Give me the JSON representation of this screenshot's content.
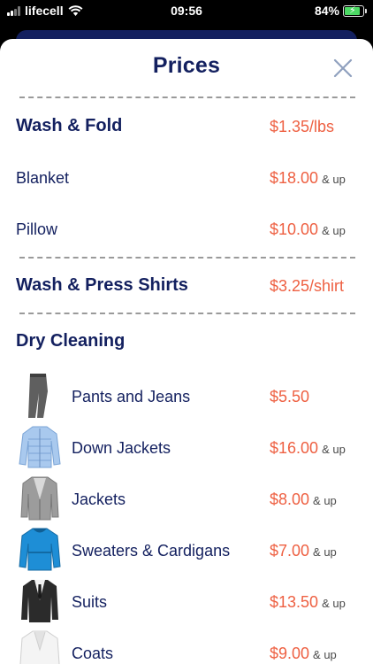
{
  "status": {
    "carrier": "lifecell",
    "time": "09:56",
    "battery": "84%",
    "battery_level": 0.84
  },
  "modal": {
    "title": "Prices"
  },
  "sections": {
    "wash_fold": {
      "name": "Wash & Fold",
      "price": "$1.35/lbs"
    },
    "blanket": {
      "name": "Blanket",
      "price": "$18.00",
      "suffix": "& up"
    },
    "pillow": {
      "name": "Pillow",
      "price": "$10.00",
      "suffix": "& up"
    },
    "wash_press": {
      "name": "Wash & Press Shirts",
      "price": "$3.25/shirt"
    },
    "dry_cleaning": {
      "name": "Dry Cleaning"
    }
  },
  "dry_cleaning_items": [
    {
      "name": "Pants and Jeans",
      "price": "$5.50",
      "suffix": "",
      "icon": "pants-icon"
    },
    {
      "name": "Down Jackets",
      "price": "$16.00",
      "suffix": "& up",
      "icon": "down-jacket-icon"
    },
    {
      "name": "Jackets",
      "price": "$8.00",
      "suffix": "& up",
      "icon": "blazer-icon"
    },
    {
      "name": "Sweaters & Cardigans",
      "price": "$7.00",
      "suffix": "& up",
      "icon": "sweater-icon"
    },
    {
      "name": "Suits",
      "price": "$13.50",
      "suffix": "& up",
      "icon": "suit-icon"
    },
    {
      "name": "Coats",
      "price": "$9.00",
      "suffix": "& up",
      "icon": "coat-icon"
    }
  ],
  "colors": {
    "navy": "#13205f",
    "price": "#ee6042"
  }
}
